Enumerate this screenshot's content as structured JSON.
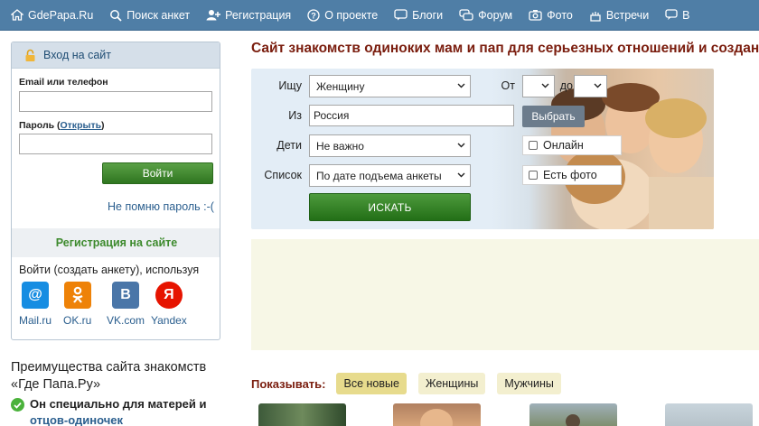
{
  "nav": {
    "items": [
      {
        "label": "GdePapa.Ru",
        "icon": "home-icon"
      },
      {
        "label": "Поиск анкет",
        "icon": "search-icon"
      },
      {
        "label": "Регистрация",
        "icon": "user-add-icon"
      },
      {
        "label": "О проекте",
        "icon": "question-icon"
      },
      {
        "label": "Блоги",
        "icon": "blog-icon"
      },
      {
        "label": "Форум",
        "icon": "forum-icon"
      },
      {
        "label": "Фото",
        "icon": "camera-icon"
      },
      {
        "label": "Встречи",
        "icon": "cake-icon"
      },
      {
        "label": "В",
        "icon": "chat-icon"
      }
    ],
    "color": "#4f7ea6"
  },
  "login": {
    "title": "Вход на сайт",
    "email_label": "Email или телефон",
    "email_value": "",
    "password_label": "Пароль",
    "password_show_link": "Открыть",
    "password_value": "",
    "submit_label": "Войти",
    "forgot_label": "Не помню пароль :-(",
    "register_label": "Регистрация на сайте",
    "social_caption": "Войти (создать анкету), используя",
    "social": [
      {
        "label": "Mail.ru",
        "icon": "mailru-icon",
        "color": "#168de2"
      },
      {
        "label": "OK.ru",
        "icon": "odnoklassniki-icon",
        "color": "#ee8208"
      },
      {
        "label": "VK.com",
        "icon": "vk-icon",
        "color": "#4a76a8"
      },
      {
        "label": "Yandex",
        "icon": "yandex-icon",
        "color": "#e61400"
      }
    ]
  },
  "advantages": {
    "title": "Преимущества сайта знакомств «Где Папа.Ру»",
    "items": [
      {
        "text": "Он специально для матерей и",
        "link": "отцов-одиночек"
      }
    ]
  },
  "main": {
    "title": "Сайт знакомств одиноких мам и пап для серьезных отношений и создания семьи"
  },
  "search": {
    "seek_label": "Ищу",
    "seek_value": "Женщину",
    "from_label": "Из",
    "from_value": "Россия",
    "choose_label": "Выбрать",
    "age_from_label": "От",
    "age_from_value": "",
    "age_to_label": "до",
    "age_to_value": "",
    "kids_label": "Дети",
    "kids_value": "Не важно",
    "list_label": "Список",
    "list_value": "По дате подъема анкеты",
    "online_label": "Онлайн",
    "online_checked": false,
    "photo_label": "Есть фото",
    "photo_checked": false,
    "submit_label": "ИСКАТЬ"
  },
  "show": {
    "label": "Показывать:",
    "filters": [
      {
        "label": "Все новые",
        "active": true
      },
      {
        "label": "Женщины",
        "active": false
      },
      {
        "label": "Мужчины",
        "active": false
      }
    ]
  }
}
